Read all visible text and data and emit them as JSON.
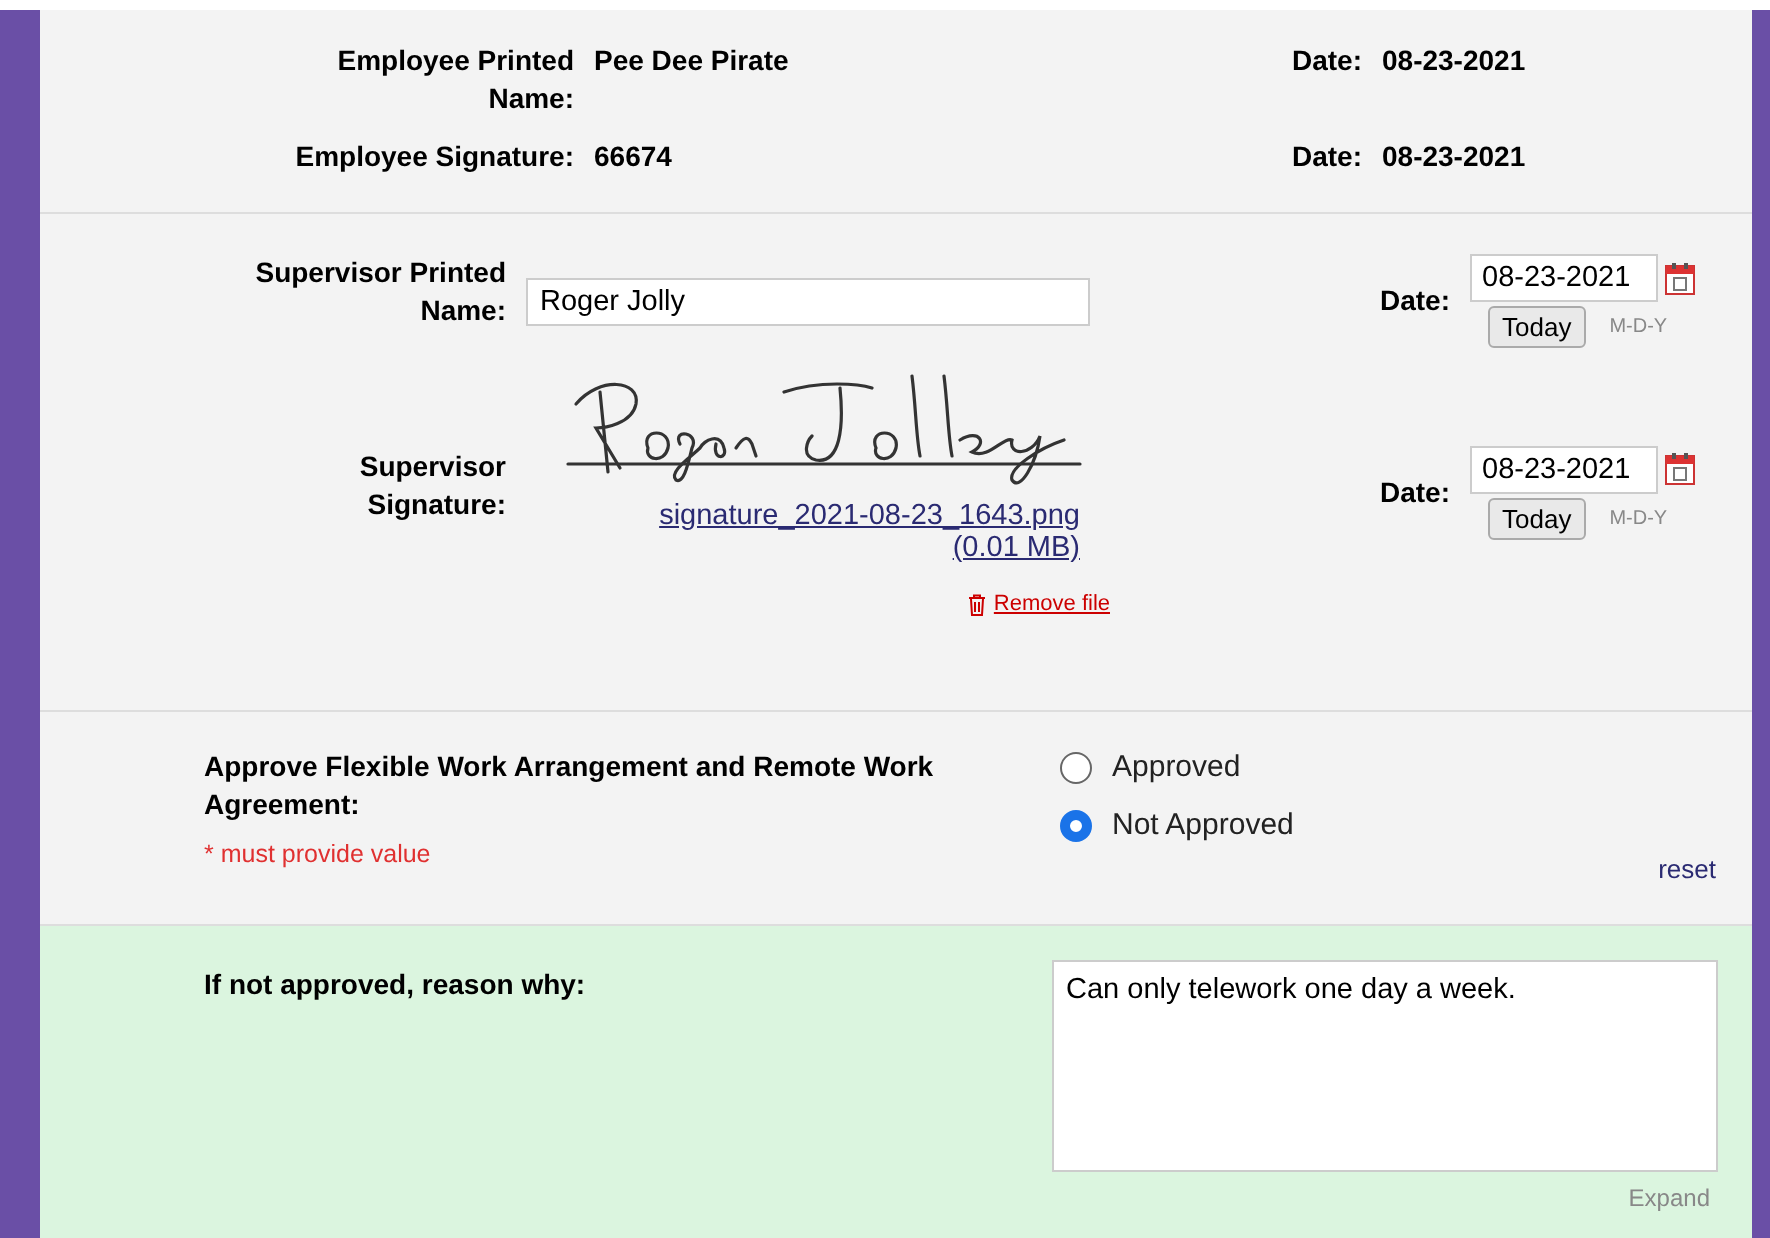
{
  "employee": [
    {
      "label": "Employee Printed Name:",
      "value": "Pee Dee Pirate",
      "date_label": "Date:",
      "date": "08-23-2021"
    },
    {
      "label": "Employee Signature:",
      "value": "66674",
      "date_label": "Date:",
      "date": "08-23-2021"
    }
  ],
  "supervisor": {
    "name_label": "Supervisor Printed Name:",
    "name_value": "Roger Jolly",
    "name_date_label": "Date:",
    "name_date": "08-23-2021",
    "today_button": "Today",
    "date_format": "M-D-Y",
    "signature_label": "Supervisor Signature:",
    "signature_file": "signature_2021-08-23_1643.png",
    "signature_size": "(0.01 MB)",
    "remove_file": "Remove file",
    "signature_date_label": "Date:",
    "signature_date": "08-23-2021",
    "signature_today_button": "Today",
    "signature_date_format": "M-D-Y"
  },
  "approval": {
    "label": "Approve Flexible Work Arrangement and Remote Work Agreement:",
    "required_note": "* must provide value",
    "options": [
      {
        "label": "Approved",
        "selected": false
      },
      {
        "label": "Not Approved",
        "selected": true
      }
    ],
    "reset": "reset"
  },
  "reason": {
    "label": "If not approved, reason why:",
    "value": "Can only telework one day a week.",
    "expand": "Expand"
  }
}
